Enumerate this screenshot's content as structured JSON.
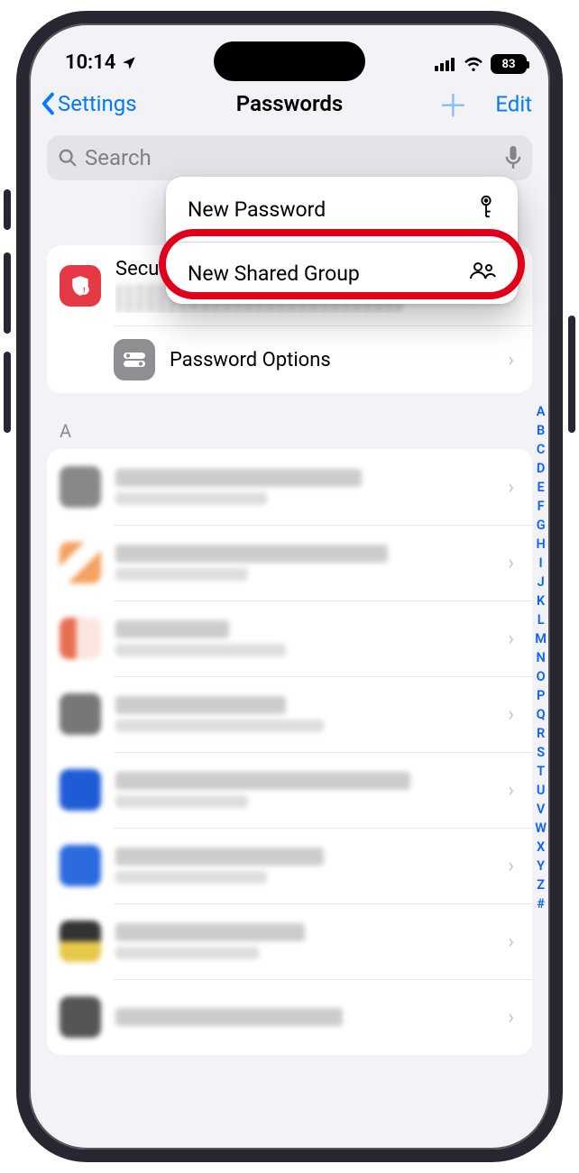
{
  "status": {
    "time": "10:14",
    "battery": "83"
  },
  "nav": {
    "back_label": "Settings",
    "title": "Passwords",
    "edit_label": "Edit"
  },
  "search": {
    "placeholder": "Search"
  },
  "popover": {
    "new_password": "New Password",
    "new_shared_group": "New Shared Group"
  },
  "settings_card": {
    "security_title": "Security Recommendations",
    "password_options": "Password Options"
  },
  "sections": {
    "A": "A"
  },
  "index_letters": [
    "A",
    "B",
    "C",
    "D",
    "E",
    "F",
    "G",
    "H",
    "I",
    "J",
    "K",
    "L",
    "M",
    "N",
    "O",
    "P",
    "Q",
    "R",
    "S",
    "T",
    "U",
    "V",
    "W",
    "X",
    "Y",
    "Z",
    "#"
  ]
}
